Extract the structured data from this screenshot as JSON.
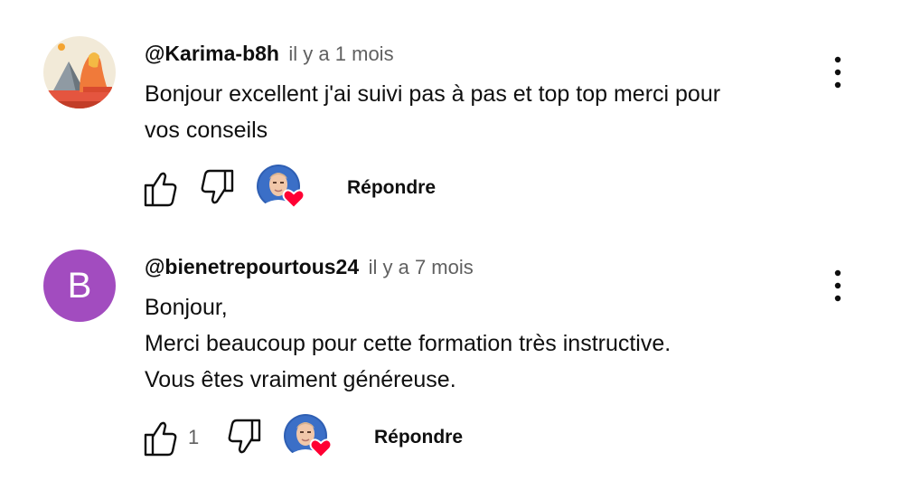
{
  "comments": [
    {
      "author": "@Karima-b8h",
      "time": "il y a 1 mois",
      "lines": [
        "Bonjour excellent j'ai suivi pas à pas et top top merci pour",
        "vos conseils"
      ],
      "avatar": {
        "type": "image",
        "icon": "sphinx-pyramid-icon"
      },
      "likes": "",
      "reply_label": "Répondre"
    },
    {
      "author": "@bienetrepourtous24",
      "time": "il y a 7 mois",
      "lines": [
        "Bonjour,",
        "Merci beaucoup pour cette formation très instructive.",
        "Vous êtes vraiment généreuse."
      ],
      "avatar": {
        "type": "letter",
        "letter": "B",
        "color": "#a24cbf"
      },
      "likes": "1",
      "reply_label": "Répondre"
    }
  ],
  "colors": {
    "heart": "#ff0033",
    "secondary_text": "#606060",
    "letter_avatar": "#a24cbf"
  }
}
